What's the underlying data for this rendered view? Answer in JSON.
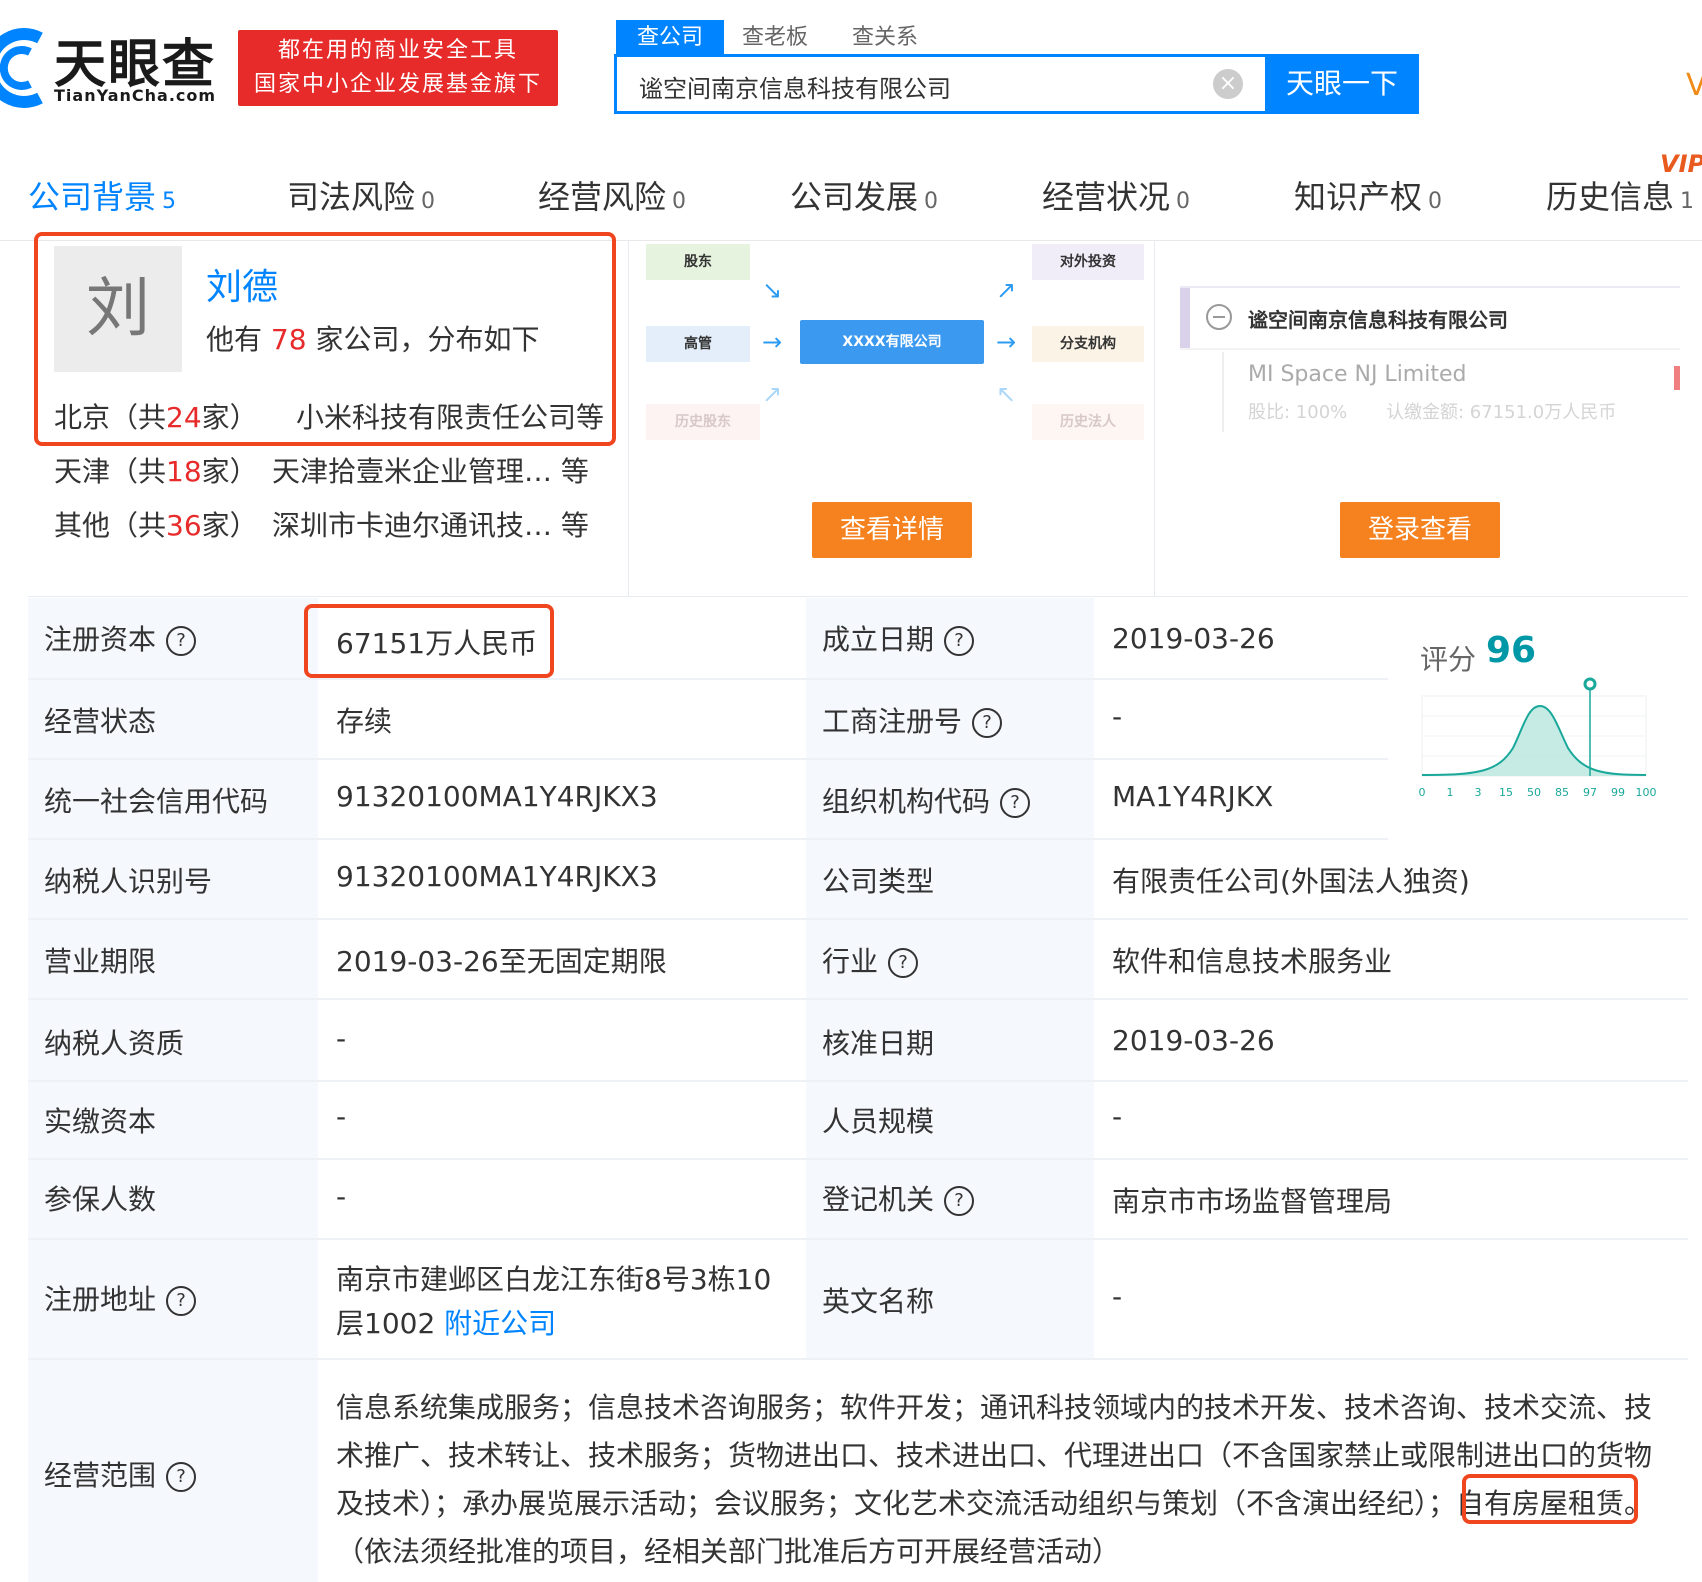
{
  "header": {
    "logo_text": "天眼查",
    "logo_sub": "TianYanCha.com",
    "slogan_line1": "都在用的商业安全工具",
    "slogan_line2": "国家中小企业发展基金旗下",
    "search_tabs": [
      "查公司",
      "查老板",
      "查关系"
    ],
    "search_value": "谧空间南京信息科技有限公司",
    "search_button": "天眼一下",
    "right_edge": "V"
  },
  "nav": {
    "vip": "VIP",
    "items": [
      {
        "label": "公司背景",
        "count": "5"
      },
      {
        "label": "司法风险",
        "count": "0"
      },
      {
        "label": "经营风险",
        "count": "0"
      },
      {
        "label": "公司发展",
        "count": "0"
      },
      {
        "label": "经营状况",
        "count": "0"
      },
      {
        "label": "知识产权",
        "count": "0"
      },
      {
        "label": "历史信息",
        "count": "1"
      }
    ]
  },
  "person": {
    "avatar_char": "刘",
    "name": "刘德",
    "line_prefix": "他有",
    "company_count": "78",
    "line_suffix": "家公司，分布如下",
    "cities": [
      {
        "pre": "北京（共",
        "num": "24",
        "post": "家）",
        "company": "小米科技有限责任公司等"
      },
      {
        "pre": "天津（共",
        "num": "18",
        "post": "家）",
        "company": "天津拾壹米企业管理… 等"
      },
      {
        "pre": "其他（共",
        "num": "36",
        "post": "家）",
        "company": "深圳市卡迪尔通讯技… 等"
      }
    ]
  },
  "relation_graph": {
    "left_nodes": [
      "股东",
      "高管",
      "历史股东"
    ],
    "center": "XXXX有限公司",
    "right_nodes": [
      "对外投资",
      "分支机构",
      "历史法人"
    ],
    "button": "查看详情"
  },
  "equity": {
    "company": "谧空间南京信息科技有限公司",
    "child_name": "MI Space NJ Limited",
    "child_ratio": "股比: 100%",
    "child_amount": "认缴金额: 67151.0万人民币",
    "button": "登录查看"
  },
  "score": {
    "label": "评分",
    "value": "96",
    "ticks": [
      "0",
      "1",
      "3",
      "15",
      "50",
      "85",
      "97",
      "99",
      "100"
    ],
    "marker_at": 96
  },
  "table": {
    "rows": [
      {
        "l1": "注册资本",
        "v1": "67151万人民币",
        "l2": "成立日期",
        "v2": "2019-03-26"
      },
      {
        "l1": "经营状态",
        "v1": "存续",
        "l2": "工商注册号",
        "v2": "-"
      },
      {
        "l1": "统一社会信用代码",
        "v1": "91320100MA1Y4RJKX3",
        "l2": "组织机构代码",
        "v2": "MA1Y4RJKX"
      },
      {
        "l1": "纳税人识别号",
        "v1": "91320100MA1Y4RJKX3",
        "l2": "公司类型",
        "v2": "有限责任公司(外国法人独资)"
      },
      {
        "l1": "营业期限",
        "v1": "2019-03-26至无固定期限",
        "l2": "行业",
        "v2": "软件和信息技术服务业"
      },
      {
        "l1": "纳税人资质",
        "v1": "-",
        "l2": "核准日期",
        "v2": "2019-03-26"
      },
      {
        "l1": "实缴资本",
        "v1": "-",
        "l2": "人员规模",
        "v2": "-"
      },
      {
        "l1": "参保人数",
        "v1": "-",
        "l2": "登记机关",
        "v2": "南京市市场监督管理局"
      },
      {
        "l1": "注册地址",
        "v1a": "南京市建邺区白龙江东街8号3栋10",
        "v1b": "层1002",
        "v1link": "附近公司",
        "l2": "英文名称",
        "v2": "-"
      }
    ],
    "scope_label": "经营范围",
    "scope_text": "信息系统集成服务；信息技术咨询服务；软件开发；通讯科技领域内的技术开发、技术咨询、技术交流、技术推广、技术转让、技术服务；货物进出口、技术进出口、代理进出口（不含国家禁止或限制进出口的货物及技术）；承办展览展示活动；会议服务；文化艺术交流活动组织与策划（不含演出经纪）；自有房屋租赁。（依法须经批准的项目，经相关部门批准后方可开展经营活动）"
  },
  "help_icon": "?",
  "clear_icon": "×",
  "colors": {
    "brand": "#0084ff",
    "highlight": "#f0461f",
    "accent_orange": "#f6821f",
    "red": "#e72a2a"
  }
}
